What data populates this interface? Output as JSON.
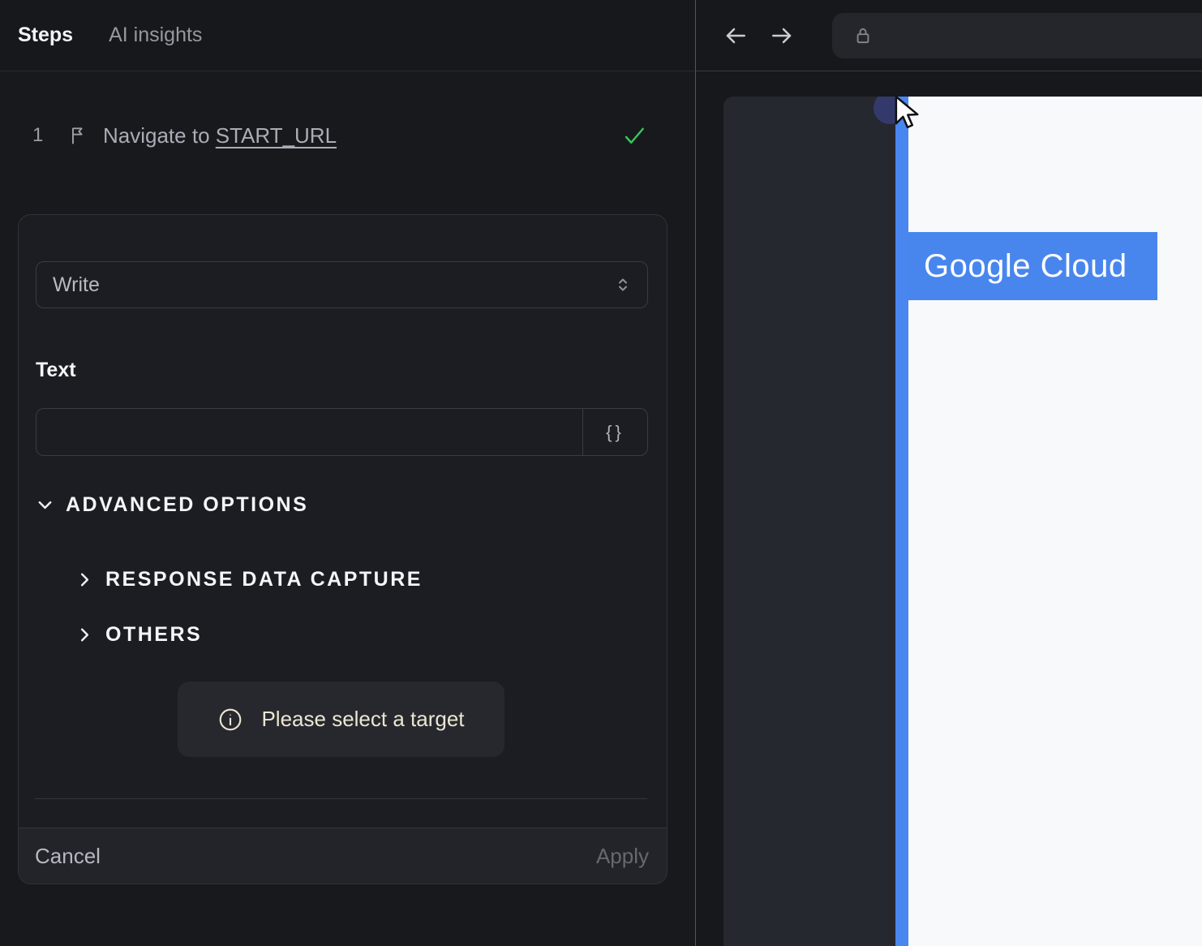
{
  "left_panel": {
    "tabs": [
      {
        "label": "Steps"
      },
      {
        "label": "AI insights"
      }
    ],
    "step": {
      "index": "1",
      "label_prefix": "Navigate to ",
      "label_link": "START_URL"
    },
    "editor": {
      "action_select": {
        "value": "Write"
      },
      "text_field": {
        "label": "Text",
        "value": "",
        "placeholder": "",
        "variable_button_label": "{}"
      },
      "advanced_options": {
        "label": "ADVANCED OPTIONS",
        "sections": [
          {
            "label": "RESPONSE DATA CAPTURE"
          },
          {
            "label": "OTHERS"
          }
        ]
      },
      "notice": {
        "text": "Please select a target"
      },
      "footer": {
        "cancel_label": "Cancel",
        "apply_label": "Apply"
      }
    }
  },
  "browser": {
    "toolbar": {
      "url_value": ""
    },
    "page": {
      "banner_text": "Google Cloud"
    }
  },
  "icons": {
    "step": "flag-icon",
    "status": "green-check-icon",
    "select": "chevrons-up-down-icon",
    "variable": "curly-braces-icon",
    "advanced": "chevron-down-icon",
    "section": "chevron-right-icon",
    "notice": "info-circle-icon",
    "back": "arrow-left-icon",
    "forward": "arrow-right-icon",
    "url": "lock-icon",
    "pointer": "mouse-cursor-icon"
  },
  "colors": {
    "page_bg": "#17191d",
    "card_bg": "#1b1d22",
    "accent_blue": "#4886ee",
    "highlight_blue": "#4a86f0",
    "success_green": "#35c759",
    "notice_cream": "#ece5d2",
    "logo_navy": "#333a6b"
  }
}
